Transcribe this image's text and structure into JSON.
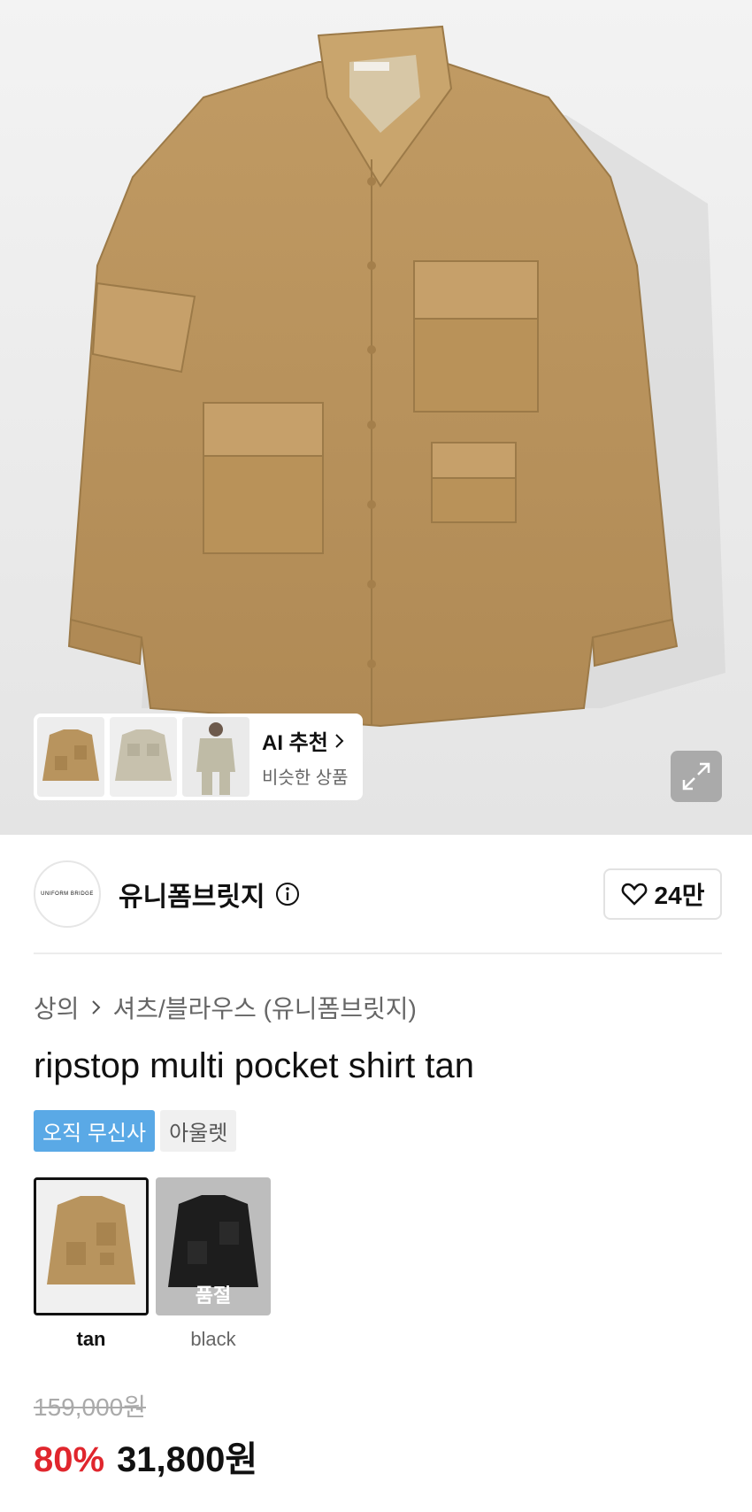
{
  "product_image": {
    "alt": "ripstop multi pocket shirt tan"
  },
  "ai_recommend": {
    "title": "AI 추천",
    "subtitle": "비슷한 상품",
    "thumbnails": [
      "tan shirt",
      "beige shirt",
      "model wearing shirt"
    ]
  },
  "brand": {
    "logo_text": "UNIFORM BRIDGE",
    "name": "유니폼브릿지",
    "likes": "24만"
  },
  "breadcrumb": {
    "category": "상의",
    "subcategory": "셔츠/블라우스 (유니폼브릿지)"
  },
  "product": {
    "title": "ripstop multi pocket shirt tan",
    "badges": {
      "exclusive": "오직 무신사",
      "outlet": "아울렛"
    }
  },
  "colors": [
    {
      "label": "tan",
      "selected": true,
      "soldout_text": ""
    },
    {
      "label": "black",
      "selected": false,
      "soldout_text": "품절"
    }
  ],
  "price": {
    "original": "159,000원",
    "discount": "80%",
    "final": "31,800원"
  },
  "theme": {
    "accent_blue": "#5aa9e6",
    "discount_red": "#e0262d",
    "shirt_tan": "#b8945e"
  }
}
